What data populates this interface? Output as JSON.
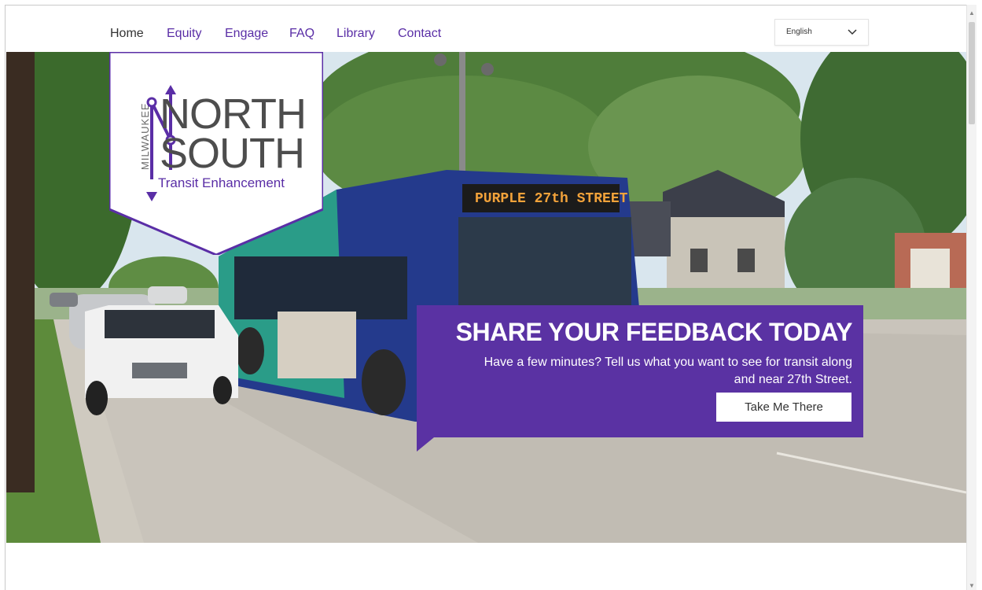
{
  "nav": {
    "items": [
      {
        "label": "Home"
      },
      {
        "label": "Equity"
      },
      {
        "label": "Engage"
      },
      {
        "label": "FAQ"
      },
      {
        "label": "Library"
      },
      {
        "label": "Contact"
      }
    ],
    "language": "English"
  },
  "logo": {
    "city": "MILWAUKEE",
    "line1": "NORTH",
    "line2": "SOUTH",
    "tagline": "Transit Enhancement"
  },
  "hero": {
    "bus_sign": "PURPLE 27th STREET",
    "headline": "SHARE YOUR FEEDBACK TODAY",
    "body": "Have a few minutes? Tell us what you want to see for transit along and near 27th Street.",
    "cta": "Take Me There",
    "slides": 5
  },
  "colors": {
    "brand_purple": "#5a32a3",
    "nav_purple": "#5a2ea6"
  },
  "icons": {
    "dropdown": "chevron-down-icon",
    "north_arrow": "arrow-up-icon",
    "south_arrow": "arrow-down-icon"
  }
}
